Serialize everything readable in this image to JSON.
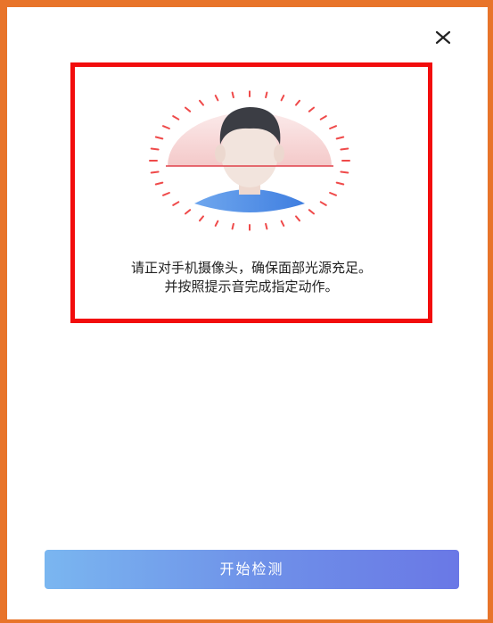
{
  "icons": {
    "close": "close-icon",
    "face": "face-outline-icon"
  },
  "instruction": {
    "line1": "请正对手机摄像头，确保面部光源充足。",
    "line2": "并按照提示音完成指定动作。"
  },
  "actions": {
    "start_label": "开始检测"
  },
  "colors": {
    "frame": "#e8742a",
    "highlight": "#f20d0d",
    "button_start": "#7ab6f0",
    "button_end": "#6a78e6",
    "scan_line": "#e0404a"
  }
}
